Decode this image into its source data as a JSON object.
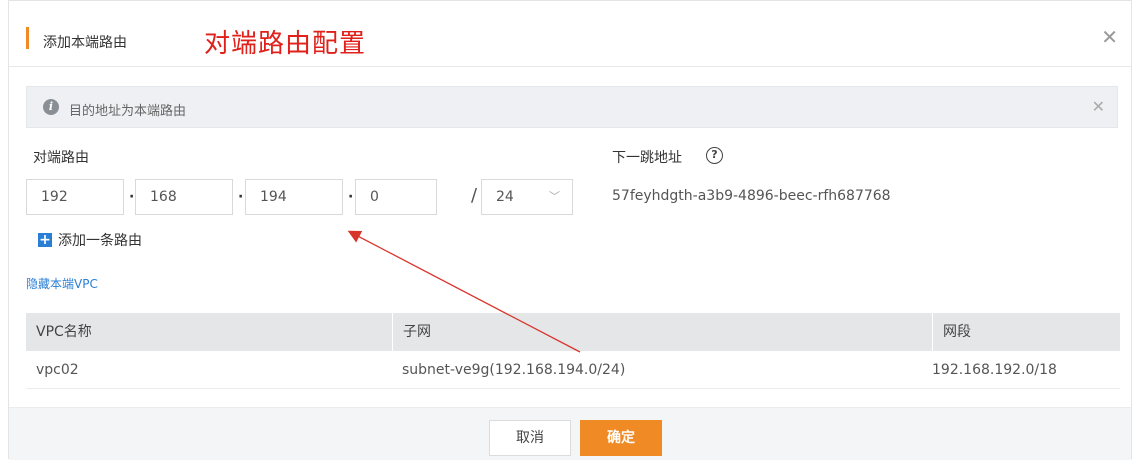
{
  "header": {
    "title": "添加本端路由",
    "annotation": "对端路由配置",
    "close_icon": "close-icon"
  },
  "notice": {
    "icon": "info-icon",
    "text": "目的地址为本端路由",
    "close_icon": "close-icon"
  },
  "form": {
    "peer_route_label": "对端路由",
    "next_hop_label": "下一跳地址",
    "ip_octets": [
      "192",
      "168",
      "194",
      "0"
    ],
    "dot": "·",
    "slash": "/",
    "mask": "24",
    "next_hop_value": "57feyhdgth-a3b9-4896-beec-rfh687768",
    "add_route_label": "添加一条路由",
    "hide_vpc_link": "隐藏本端VPC"
  },
  "vpc_table": {
    "columns": [
      "VPC名称",
      "子网",
      "网段"
    ],
    "rows": [
      [
        "vpc02",
        "subnet-ve9g(192.168.194.0/24)",
        "192.168.192.0/18"
      ]
    ]
  },
  "footer": {
    "cancel_label": "取消",
    "ok_label": "确定"
  },
  "colors": {
    "accent": "#f08a24",
    "annotation": "#e0201a",
    "link": "#2a7fd4"
  }
}
